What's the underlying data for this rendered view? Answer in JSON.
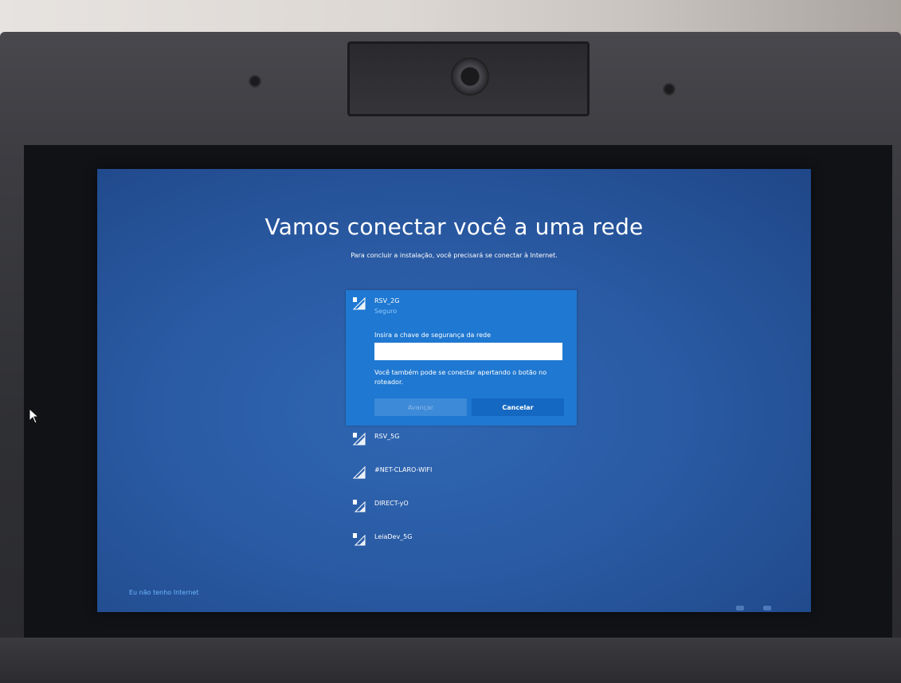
{
  "screen": {
    "title": "Vamos conectar você a uma rede",
    "subtitle": "Para concluir a instalação, você precisará se conectar à Internet."
  },
  "selected_network": {
    "ssid": "RSV_2G",
    "status": "Seguro",
    "key_label": "Insira a chave de segurança da rede",
    "key_value": "",
    "hint": "Você também pode se conectar apertando o botão no roteador.",
    "next_label": "Avançar",
    "cancel_label": "Cancelar"
  },
  "networks": [
    {
      "ssid": "RSV_5G",
      "icon": "wifi-secured-icon"
    },
    {
      "ssid": "#NET-CLARO-WIFI",
      "icon": "wifi-open-icon"
    },
    {
      "ssid": "DIRECT-yO",
      "icon": "wifi-secured-icon"
    },
    {
      "ssid": "LeiaDev_5G",
      "icon": "wifi-secured-icon"
    }
  ],
  "no_internet_link": "Eu não tenho Internet",
  "colors": {
    "background": "#2a5ba4",
    "selected_panel": "#1f78d1",
    "link": "#6fb6ff"
  }
}
